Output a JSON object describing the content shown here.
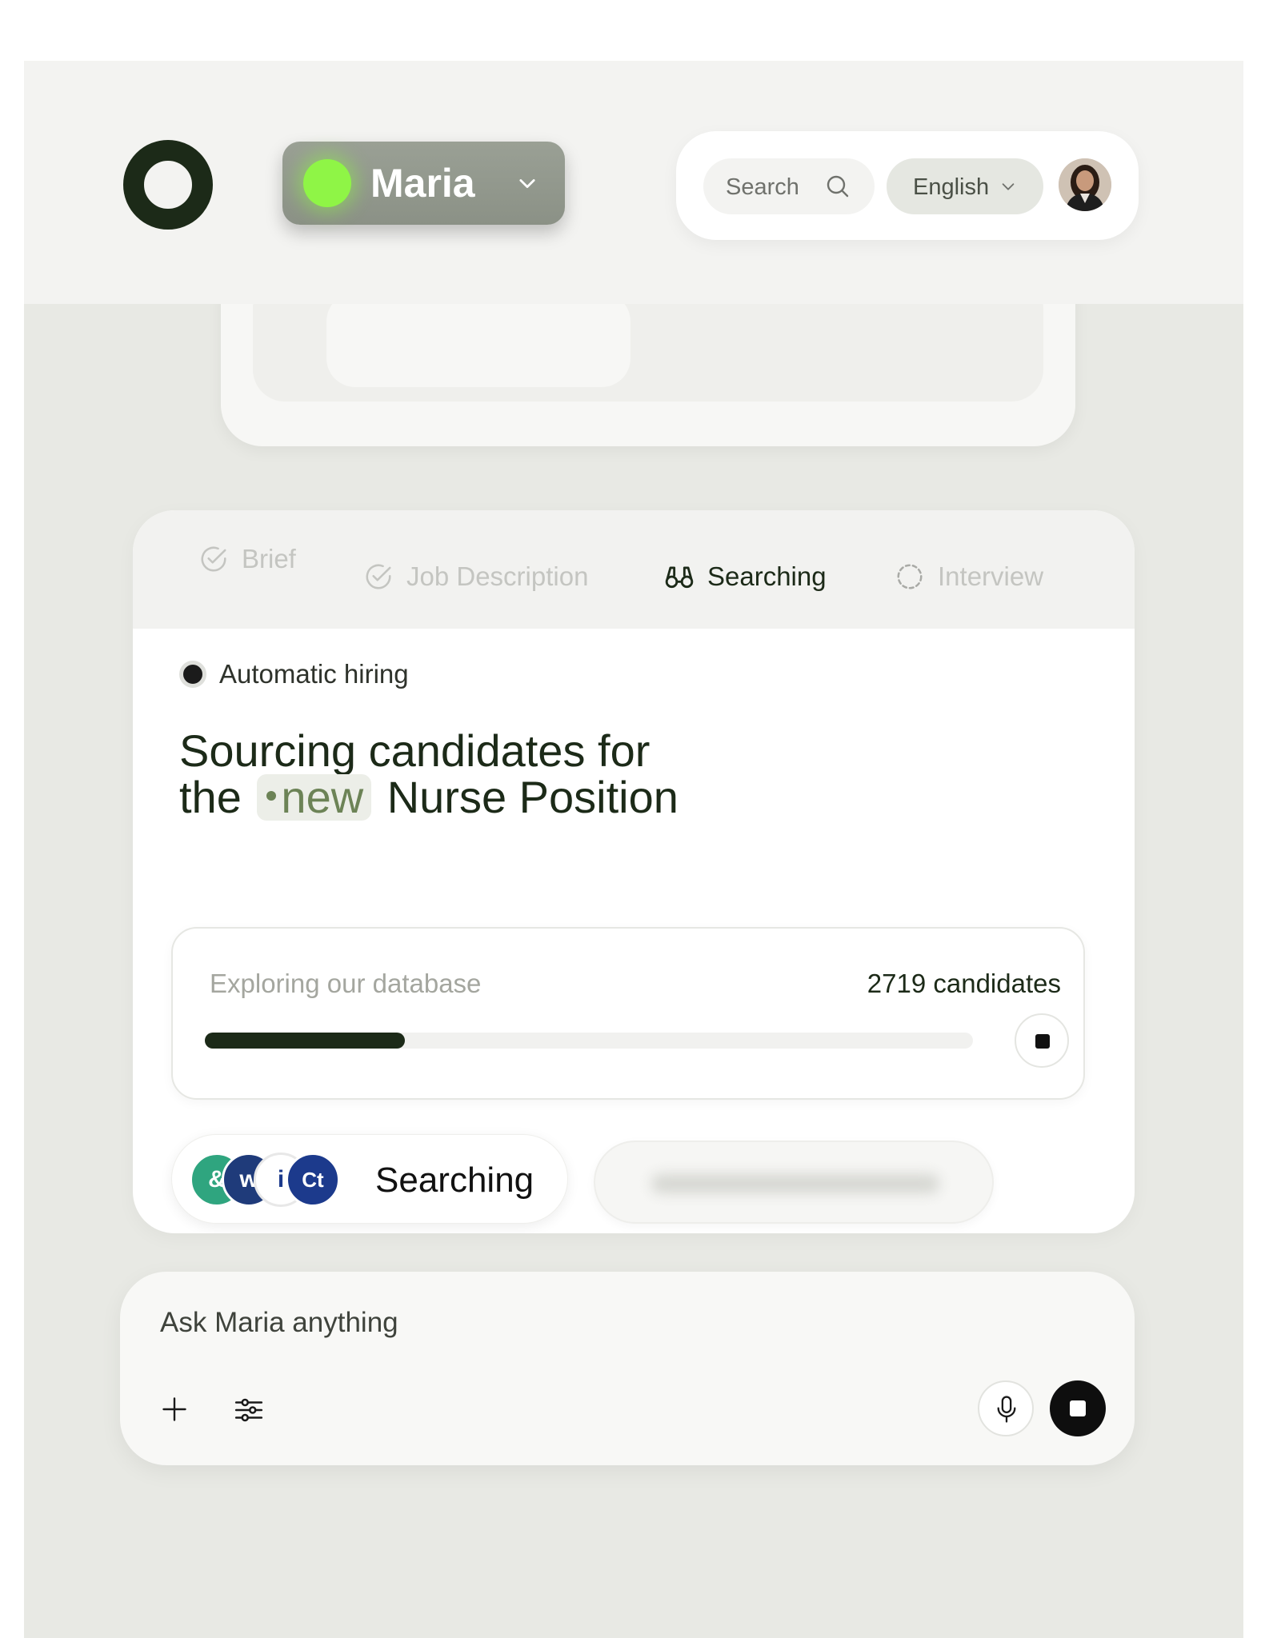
{
  "header": {
    "agent": {
      "name": "Maria",
      "status_color": "#8ff546"
    },
    "search": {
      "placeholder": "Search"
    },
    "language": {
      "selected": "English"
    }
  },
  "stepper": {
    "steps": [
      {
        "label": "Brief",
        "state": "done",
        "icon": "check-circle-icon"
      },
      {
        "label": "Job Description",
        "state": "done",
        "icon": "check-circle-icon"
      },
      {
        "label": "Searching",
        "state": "active",
        "icon": "binoculars-icon"
      },
      {
        "label": "Interview",
        "state": "pending",
        "icon": "dashed-circle-icon"
      }
    ]
  },
  "content": {
    "mode_label": "Automatic hiring",
    "headline_line1": "Sourcing candidates for",
    "headline_the": "the",
    "headline_tag": "new",
    "headline_rest": "Nurse Position"
  },
  "progress": {
    "label": "Exploring our database",
    "count_text": "2719 candidates",
    "fraction": 0.26
  },
  "sources": {
    "status_text": "Searching",
    "logos": [
      {
        "name": "source-logo-green",
        "color": "#2fa57f",
        "glyph": "&"
      },
      {
        "name": "source-logo-w",
        "color": "#1f3b7a",
        "glyph": "w"
      },
      {
        "name": "source-logo-i",
        "color": "#ffffff",
        "glyph": "i"
      },
      {
        "name": "source-logo-ct",
        "color": "#1c3a8c",
        "glyph": "Ct"
      }
    ]
  },
  "chat": {
    "placeholder": "Ask Maria anything"
  },
  "colors": {
    "accent_dark": "#1c2a18",
    "background": "#e8e9e4"
  }
}
